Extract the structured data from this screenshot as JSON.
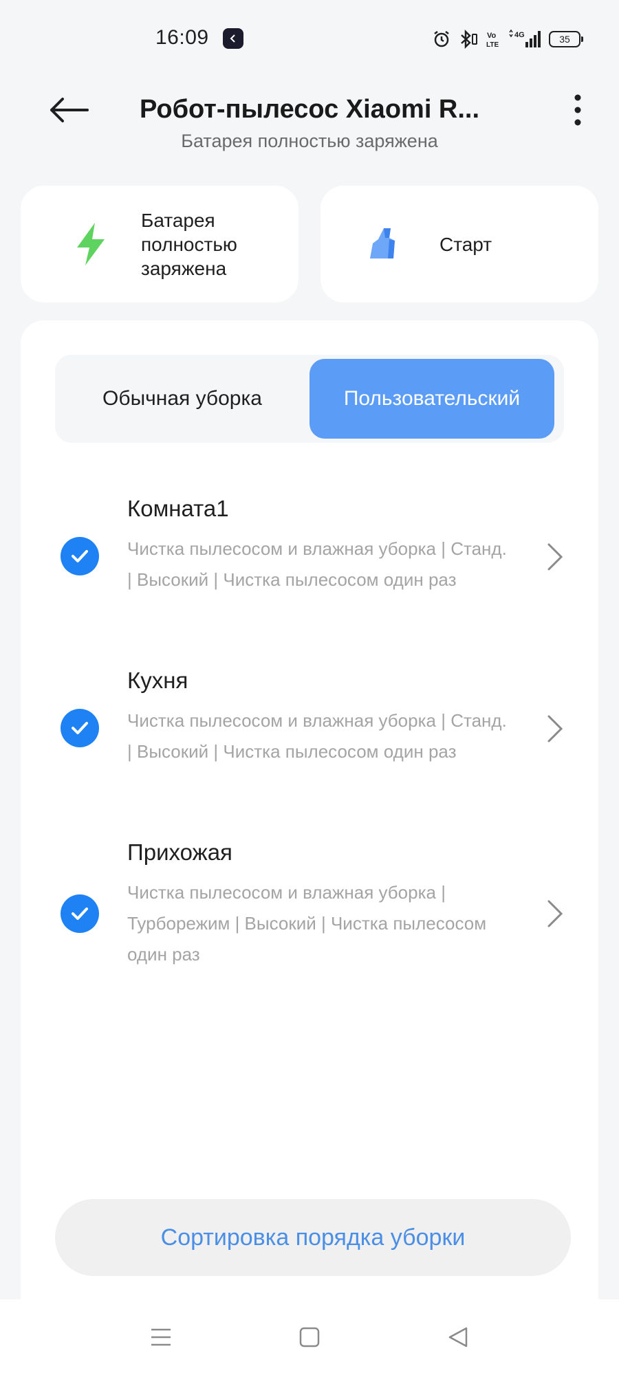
{
  "status_bar": {
    "time": "16:09",
    "network": "4G",
    "volte": "Vo LTE",
    "battery_level": "35"
  },
  "header": {
    "title": "Робот-пылесос Xiaomi R...",
    "subtitle": "Батарея полностью заряжена"
  },
  "quick_actions": {
    "battery_label": "Батарея полностью заряжена",
    "start_label": "Старт"
  },
  "mode_tabs": [
    {
      "label": "Обычная уборка",
      "active": false
    },
    {
      "label": "Пользовательский",
      "active": true
    }
  ],
  "rooms": [
    {
      "name": "Комната1",
      "desc_line1": "Чистка пылесосом и влажная уборка  |  Станд.",
      "desc_line2": "|  Высокий  |  Чистка пылесосом один раз",
      "desc_line3": "",
      "checked": true
    },
    {
      "name": "Кухня",
      "desc_line1": "Чистка пылесосом и влажная уборка  |  Станд.",
      "desc_line2": "|  Высокий  |  Чистка пылесосом один раз",
      "desc_line3": "",
      "checked": true
    },
    {
      "name": "Прихожая",
      "desc_line1": "Чистка пылесосом и влажная уборка  |",
      "desc_line2": "Турборежим  |  Высокий  |  Чистка пылесосом",
      "desc_line3": "один раз",
      "checked": true
    }
  ],
  "sort_button_label": "Сортировка порядка уборки",
  "colors": {
    "accent": "#5b9cf6",
    "check": "#1e82f5",
    "link": "#4a8ee6",
    "battery_icon": "#5fd35f"
  }
}
